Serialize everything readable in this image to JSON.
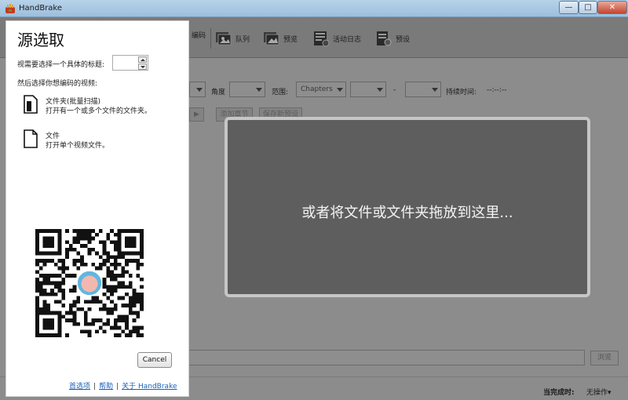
{
  "window": {
    "title": "HandBrake",
    "min_glyph": "—",
    "max_glyph": "□",
    "close_glyph": "✕"
  },
  "toolbar": {
    "items": [
      {
        "label": "编码",
        "icon": "encode-icon"
      },
      {
        "label": "队列",
        "icon": "queue-icon"
      },
      {
        "label": "预览",
        "icon": "preview-icon"
      },
      {
        "label": "活动日志",
        "icon": "activity-log-icon"
      },
      {
        "label": "预设",
        "icon": "presets-icon"
      }
    ]
  },
  "source_row": {
    "angle_label": "角度",
    "range_label": "范围:",
    "range_type": "Chapters",
    "dash": "-",
    "duration_label": "持续时间:",
    "duration_value": "--:--:--"
  },
  "ghost_buttons": {
    "play_glyph": "▶",
    "add_chapters": "添加章节",
    "save_preset": "保存新预设"
  },
  "dropzone": {
    "text": "或者将文件或文件夹拖放到这里..."
  },
  "destination": {
    "browse_label": "浏览"
  },
  "status": {
    "when_done_label": "当完成时:",
    "when_done_value": "无操作▾"
  },
  "flyout": {
    "title": "源选取",
    "title_prompt": "视需要选择一个具体的标题:",
    "title_value": "",
    "video_prompt": "然后选择你想编码的视频:",
    "folder_option": {
      "name": "文件夹(批量扫描)",
      "desc": "打开有一个或多个文件的文件夹。",
      "icon": "folder-icon"
    },
    "file_option": {
      "name": "文件",
      "desc": "打开单个视频文件。",
      "icon": "file-icon"
    },
    "qr_icon": "qr-code",
    "cancel_label": "Cancel",
    "links": {
      "preferences": "首选项",
      "help": "帮助",
      "about": "关于 HandBrake",
      "separator": "|"
    }
  },
  "colors": {
    "overlay_bg": "#8c8c8c",
    "dropzone_bg": "#5e5e5e",
    "link": "#1b5fb8",
    "titlebar": "#b7d2ea"
  }
}
